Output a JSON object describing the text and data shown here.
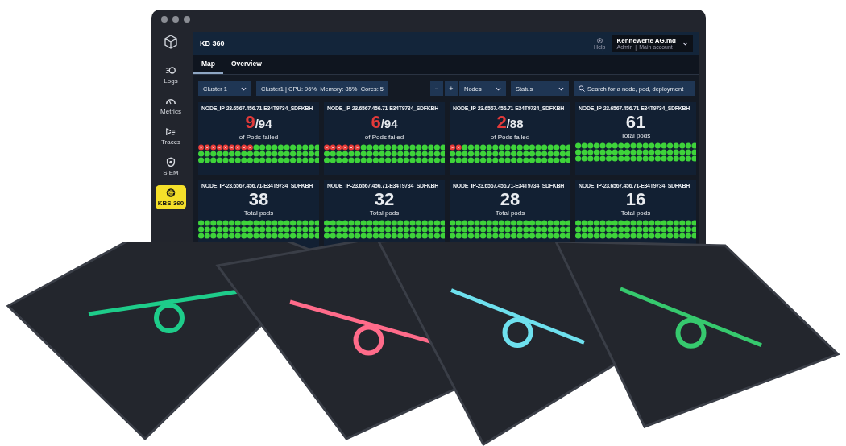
{
  "sidebar": {
    "items": [
      {
        "label": "Logs",
        "selected": false
      },
      {
        "label": "Metrics",
        "selected": false
      },
      {
        "label": "Traces",
        "selected": false
      },
      {
        "label": "SIEM",
        "selected": false
      },
      {
        "label": "KBS 360",
        "selected": true
      }
    ]
  },
  "header": {
    "title": "KB 360",
    "help": "Help",
    "account": {
      "name": "Kennewerte AG.md",
      "role": "Admin",
      "separator": "|",
      "plan": "Main account"
    }
  },
  "tabs": [
    {
      "label": "Map",
      "selected": true
    },
    {
      "label": "Overview",
      "selected": false
    }
  ],
  "filters": {
    "cluster": "Cluster 1",
    "cluster_info": "Cluster1 | CPU: 96%  Memory: 85%  Cores: 5",
    "zoom_out": "−",
    "zoom_in": "+",
    "nodes": "Nodes",
    "status": "Status",
    "search": {
      "placeholder": "Search for a node, pod, deployment"
    }
  },
  "cards": [
    {
      "kind": "failed",
      "node": "NODE_IP-23.6567.456.71-E34T9734_SDFKBH",
      "count": "9",
      "total": "/94",
      "label": "of Pods failed"
    },
    {
      "kind": "failed",
      "node": "NODE_IP-23.6567.456.71-E34T9734_SDFKBH",
      "count": "6",
      "total": "/94",
      "label": "of Pods failed"
    },
    {
      "kind": "failed",
      "node": "NODE_IP-23.6567.456.71-E34T9734_SDFKBH",
      "count": "2",
      "total": "/88",
      "label": "of Pods failed"
    },
    {
      "kind": "total",
      "node": "NODE_IP-23.6567.456.71-E34T9734_SDFKBH",
      "count": "61",
      "label": "Total pods"
    },
    {
      "kind": "total",
      "node": "NODE_IP-23.6567.456.71-E34T9734_SDFKBH",
      "count": "38",
      "label": "Total pods"
    },
    {
      "kind": "total",
      "node": "NODE_IP-23.6567.456.71-E34T9734_SDFKBH",
      "count": "32",
      "label": "Total pods"
    },
    {
      "kind": "total",
      "node": "NODE_IP-23.6567.456.71-E34T9734_SDFKBH",
      "count": "28",
      "label": "Total pods"
    },
    {
      "kind": "total",
      "node": "NODE_IP-23.6567.456.71-E34T9734_SDFKBH",
      "count": "16",
      "label": "Total pods"
    }
  ]
}
